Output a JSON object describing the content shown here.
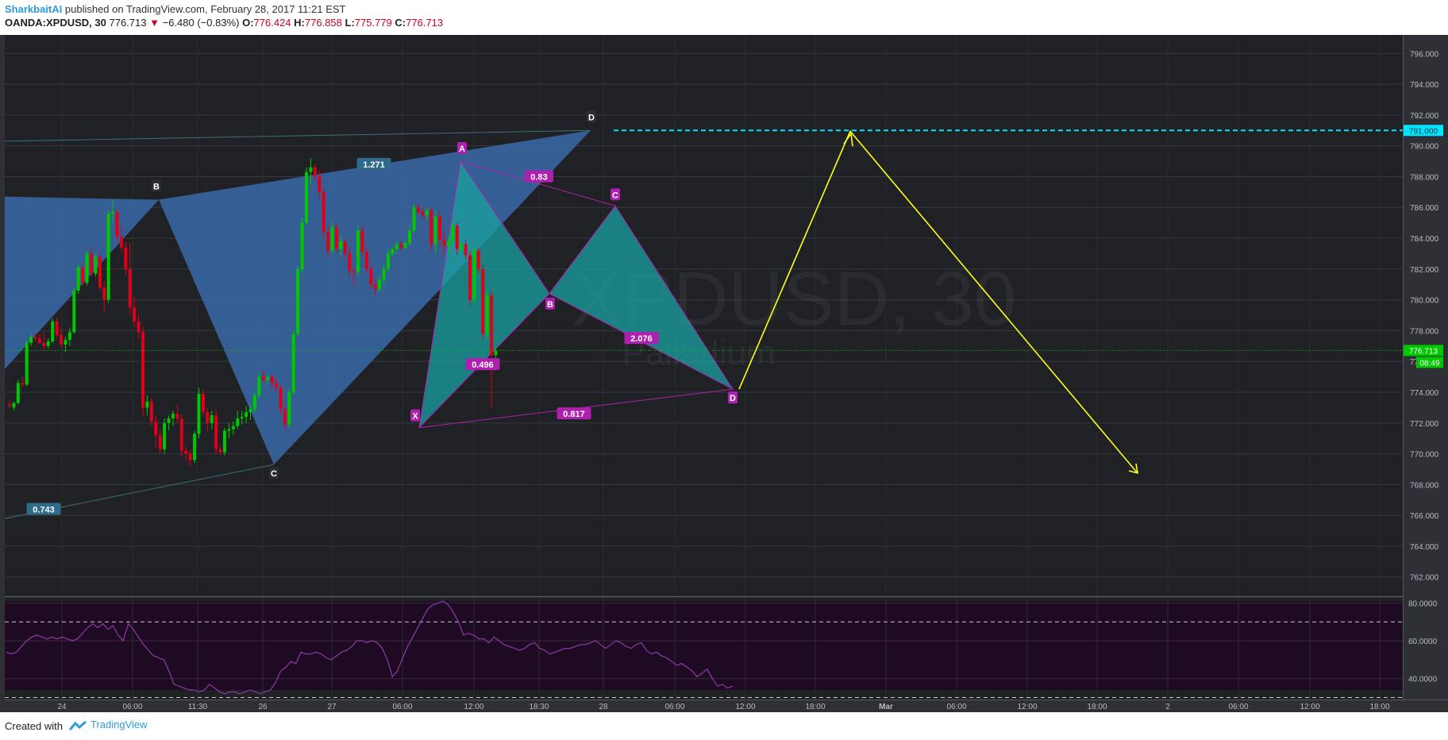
{
  "header": {
    "author": "SharkbaitAI",
    "published": "published on TradingView.com, February 28, 2017 11:21 EST",
    "symbol": "OANDA:XPDUSD, 30",
    "last": "776.713",
    "change_arrow": "▼",
    "change": "−6.480 (−0.83%)",
    "o_label": "O:",
    "o": "776.424",
    "h_label": "H:",
    "h": "776.858",
    "l_label": "L:",
    "l": "775.779",
    "c_label": "C:",
    "c": "776.713"
  },
  "watermark": {
    "symbol": "XPDUSD, 30",
    "name": "Palladium"
  },
  "footer": {
    "created_with": "Created with",
    "tradingview": "TradingView"
  },
  "colors": {
    "up": "#00c800",
    "down": "#e0001b",
    "harmonic_blue": "#3a6aa8",
    "harmonic_teal": "#1aa0a0",
    "harmonic_purple": "#b020b0",
    "target_line": "#00e5ff",
    "projection": "#ffff1a",
    "rsi_line": "#8e3aa8",
    "rsi_bg": "#1e0a22"
  },
  "chart_data": [
    {
      "type": "candlestick",
      "title": "OANDA:XPDUSD, 30",
      "ylim": [
        760.8,
        797.2
      ],
      "y_ticks": [
        "796.000",
        "794.000",
        "792.000",
        "790.000",
        "788.000",
        "786.000",
        "784.000",
        "782.000",
        "780.000",
        "778.000",
        "776.000",
        "774.000",
        "772.000",
        "770.000",
        "768.000",
        "766.000",
        "764.000",
        "762.000"
      ],
      "x_ticks": [
        "24",
        "06:00",
        "11:30",
        "26",
        "27",
        "06:00",
        "12:00",
        "18:30",
        "28",
        "06:00",
        "12:00",
        "18:00",
        "Mar",
        "06:00",
        "12:00",
        "18:00",
        "2",
        "06:00",
        "12:00",
        "18:00"
      ],
      "price_labels": {
        "target": {
          "value": 791.0,
          "label": "791.000"
        },
        "last": {
          "value": 776.713,
          "label": "776.713"
        },
        "countdown": "08:49"
      },
      "harmonic_patterns": [
        {
          "name": "blue",
          "points": {
            "X": 775.5,
            "A": 786.5,
            "B": 769.3,
            "C": 791.0
          },
          "labels": [
            {
              "text": "B",
              "value": 786.5
            },
            {
              "text": "C",
              "value": 769.3
            },
            {
              "text": "D",
              "value": 791.0
            }
          ],
          "ratios": [
            "1.271",
            "0.743"
          ]
        },
        {
          "name": "purple",
          "points": {
            "X": 771.7,
            "A": 789.0,
            "B": 780.4,
            "C": 786.1,
            "D": 774.2
          },
          "labels": [
            "X",
            "A",
            "B",
            "C",
            "D"
          ],
          "ratios": [
            "0.83",
            "0.496",
            "2.076",
            "0.817"
          ]
        }
      ],
      "projection_path": {
        "from": 774.2,
        "peak": 791.0,
        "target": 768.8
      },
      "candles": [
        {
          "o": 773.2,
          "h": 773.5,
          "l": 773.0,
          "c": 773.1
        },
        {
          "o": 773.0,
          "h": 773.4,
          "l": 772.8,
          "c": 773.3
        },
        {
          "o": 773.3,
          "h": 774.8,
          "l": 773.2,
          "c": 774.6
        },
        {
          "o": 774.6,
          "h": 775.0,
          "l": 774.3,
          "c": 774.5
        },
        {
          "o": 774.5,
          "h": 777.4,
          "l": 774.4,
          "c": 777.2
        },
        {
          "o": 777.2,
          "h": 777.8,
          "l": 777.0,
          "c": 777.6
        },
        {
          "o": 777.6,
          "h": 777.8,
          "l": 777.3,
          "c": 777.5
        },
        {
          "o": 777.5,
          "h": 777.8,
          "l": 777.1,
          "c": 777.2
        },
        {
          "o": 777.2,
          "h": 777.9,
          "l": 776.7,
          "c": 777.0
        },
        {
          "o": 777.0,
          "h": 777.5,
          "l": 776.8,
          "c": 777.3
        },
        {
          "o": 777.3,
          "h": 778.8,
          "l": 777.2,
          "c": 778.6
        },
        {
          "o": 778.6,
          "h": 778.9,
          "l": 777.5,
          "c": 777.7
        },
        {
          "o": 777.7,
          "h": 778.2,
          "l": 776.9,
          "c": 777.1
        },
        {
          "o": 777.1,
          "h": 777.6,
          "l": 776.6,
          "c": 777.4
        },
        {
          "o": 777.4,
          "h": 778.2,
          "l": 777.0,
          "c": 777.9
        },
        {
          "o": 777.9,
          "h": 780.8,
          "l": 777.8,
          "c": 780.6
        },
        {
          "o": 780.6,
          "h": 782.3,
          "l": 780.4,
          "c": 782.1
        },
        {
          "o": 782.1,
          "h": 782.3,
          "l": 780.9,
          "c": 781.1
        },
        {
          "o": 781.1,
          "h": 783.2,
          "l": 780.9,
          "c": 783.0
        },
        {
          "o": 783.0,
          "h": 783.4,
          "l": 781.5,
          "c": 781.7
        },
        {
          "o": 781.7,
          "h": 783.0,
          "l": 781.5,
          "c": 782.8
        },
        {
          "o": 782.8,
          "h": 783.0,
          "l": 780.6,
          "c": 780.8
        },
        {
          "o": 780.8,
          "h": 781.2,
          "l": 779.2,
          "c": 780.0
        },
        {
          "o": 780.0,
          "h": 785.8,
          "l": 779.8,
          "c": 785.6
        },
        {
          "o": 785.6,
          "h": 786.5,
          "l": 785.0,
          "c": 785.7
        },
        {
          "o": 785.7,
          "h": 785.9,
          "l": 783.8,
          "c": 784.1
        },
        {
          "o": 784.1,
          "h": 784.8,
          "l": 783.0,
          "c": 783.4
        },
        {
          "o": 783.4,
          "h": 783.8,
          "l": 781.6,
          "c": 782.0
        },
        {
          "o": 782.0,
          "h": 783.7,
          "l": 779.0,
          "c": 779.5
        },
        {
          "o": 779.5,
          "h": 780.2,
          "l": 778.3,
          "c": 778.6
        },
        {
          "o": 778.6,
          "h": 779.0,
          "l": 777.5,
          "c": 777.9
        },
        {
          "o": 777.9,
          "h": 778.2,
          "l": 772.4,
          "c": 773.0
        },
        {
          "o": 773.0,
          "h": 773.8,
          "l": 772.5,
          "c": 773.4
        },
        {
          "o": 773.4,
          "h": 773.6,
          "l": 771.8,
          "c": 772.1
        },
        {
          "o": 772.1,
          "h": 772.5,
          "l": 770.4,
          "c": 771.2
        },
        {
          "o": 771.2,
          "h": 771.6,
          "l": 770.0,
          "c": 770.3
        },
        {
          "o": 770.3,
          "h": 772.3,
          "l": 770.0,
          "c": 772.0
        },
        {
          "o": 772.0,
          "h": 772.5,
          "l": 771.5,
          "c": 772.3
        },
        {
          "o": 772.3,
          "h": 772.8,
          "l": 771.8,
          "c": 772.6
        },
        {
          "o": 772.6,
          "h": 773.2,
          "l": 772.0,
          "c": 772.3
        },
        {
          "o": 772.3,
          "h": 772.6,
          "l": 769.8,
          "c": 770.2
        },
        {
          "o": 770.2,
          "h": 770.5,
          "l": 769.5,
          "c": 770.0
        },
        {
          "o": 770.0,
          "h": 770.3,
          "l": 769.2,
          "c": 769.6
        },
        {
          "o": 769.6,
          "h": 771.5,
          "l": 769.4,
          "c": 771.3
        },
        {
          "o": 771.3,
          "h": 774.3,
          "l": 771.0,
          "c": 773.9
        },
        {
          "o": 773.9,
          "h": 774.2,
          "l": 772.4,
          "c": 772.7
        },
        {
          "o": 772.7,
          "h": 773.0,
          "l": 771.5,
          "c": 772.0
        },
        {
          "o": 772.0,
          "h": 772.8,
          "l": 771.6,
          "c": 772.5
        },
        {
          "o": 772.5,
          "h": 772.9,
          "l": 770.0,
          "c": 770.3
        },
        {
          "o": 770.3,
          "h": 770.5,
          "l": 769.9,
          "c": 770.1
        },
        {
          "o": 770.1,
          "h": 771.7,
          "l": 769.9,
          "c": 771.5
        },
        {
          "o": 771.5,
          "h": 772.0,
          "l": 771.0,
          "c": 771.6
        },
        {
          "o": 771.6,
          "h": 772.1,
          "l": 771.2,
          "c": 771.8
        },
        {
          "o": 771.8,
          "h": 772.8,
          "l": 771.6,
          "c": 772.3
        },
        {
          "o": 772.3,
          "h": 772.8,
          "l": 771.9,
          "c": 772.4
        },
        {
          "o": 772.4,
          "h": 773.1,
          "l": 772.0,
          "c": 772.7
        },
        {
          "o": 772.7,
          "h": 773.2,
          "l": 772.2,
          "c": 772.9
        },
        {
          "o": 772.9,
          "h": 774.0,
          "l": 772.7,
          "c": 773.8
        },
        {
          "o": 773.8,
          "h": 775.3,
          "l": 773.6,
          "c": 775.0
        },
        {
          "o": 775.0,
          "h": 775.4,
          "l": 774.6,
          "c": 774.8
        },
        {
          "o": 774.8,
          "h": 775.2,
          "l": 774.5,
          "c": 775.0
        },
        {
          "o": 775.0,
          "h": 775.1,
          "l": 774.3,
          "c": 774.6
        },
        {
          "o": 774.6,
          "h": 774.9,
          "l": 774.0,
          "c": 774.3
        },
        {
          "o": 774.3,
          "h": 774.5,
          "l": 772.6,
          "c": 772.9
        },
        {
          "o": 772.9,
          "h": 773.2,
          "l": 771.5,
          "c": 771.9
        },
        {
          "o": 771.9,
          "h": 774.3,
          "l": 771.7,
          "c": 774.0
        },
        {
          "o": 774.0,
          "h": 778.0,
          "l": 773.8,
          "c": 777.8
        },
        {
          "o": 777.8,
          "h": 782.2,
          "l": 777.6,
          "c": 782.0
        },
        {
          "o": 782.0,
          "h": 785.3,
          "l": 781.8,
          "c": 785.0
        },
        {
          "o": 785.0,
          "h": 788.6,
          "l": 784.8,
          "c": 788.3
        },
        {
          "o": 788.3,
          "h": 789.2,
          "l": 787.5,
          "c": 788.6
        },
        {
          "o": 788.6,
          "h": 788.8,
          "l": 787.8,
          "c": 788.0
        },
        {
          "o": 788.0,
          "h": 788.4,
          "l": 786.6,
          "c": 787.0
        },
        {
          "o": 787.0,
          "h": 787.3,
          "l": 784.0,
          "c": 784.4
        },
        {
          "o": 784.4,
          "h": 784.8,
          "l": 782.8,
          "c": 783.2
        },
        {
          "o": 783.2,
          "h": 785.0,
          "l": 783.0,
          "c": 784.7
        },
        {
          "o": 784.7,
          "h": 785.0,
          "l": 783.0,
          "c": 783.3
        },
        {
          "o": 783.3,
          "h": 784.2,
          "l": 782.9,
          "c": 783.8
        },
        {
          "o": 783.8,
          "h": 784.0,
          "l": 782.7,
          "c": 783.0
        },
        {
          "o": 783.0,
          "h": 783.4,
          "l": 781.5,
          "c": 781.9
        },
        {
          "o": 781.9,
          "h": 782.2,
          "l": 780.9,
          "c": 781.8
        },
        {
          "o": 781.8,
          "h": 784.8,
          "l": 781.6,
          "c": 784.5
        },
        {
          "o": 784.5,
          "h": 784.8,
          "l": 782.8,
          "c": 783.1
        },
        {
          "o": 783.1,
          "h": 783.4,
          "l": 781.7,
          "c": 782.0
        },
        {
          "o": 782.0,
          "h": 782.3,
          "l": 780.7,
          "c": 781.0
        },
        {
          "o": 781.0,
          "h": 781.4,
          "l": 780.3,
          "c": 780.7
        },
        {
          "o": 780.7,
          "h": 781.6,
          "l": 780.5,
          "c": 781.3
        },
        {
          "o": 781.3,
          "h": 782.3,
          "l": 781.0,
          "c": 782.0
        },
        {
          "o": 782.0,
          "h": 783.3,
          "l": 781.8,
          "c": 783.0
        },
        {
          "o": 783.0,
          "h": 783.5,
          "l": 782.8,
          "c": 783.3
        },
        {
          "o": 783.3,
          "h": 783.8,
          "l": 783.0,
          "c": 783.6
        },
        {
          "o": 783.6,
          "h": 783.8,
          "l": 783.2,
          "c": 783.4
        },
        {
          "o": 783.4,
          "h": 783.9,
          "l": 783.2,
          "c": 783.7
        },
        {
          "o": 783.7,
          "h": 784.8,
          "l": 783.5,
          "c": 784.5
        },
        {
          "o": 784.5,
          "h": 786.2,
          "l": 784.3,
          "c": 786.0
        },
        {
          "o": 786.0,
          "h": 786.3,
          "l": 785.5,
          "c": 785.7
        },
        {
          "o": 785.7,
          "h": 786.0,
          "l": 785.2,
          "c": 785.5
        },
        {
          "o": 785.5,
          "h": 786.0,
          "l": 785.2,
          "c": 785.8
        },
        {
          "o": 785.8,
          "h": 786.0,
          "l": 783.2,
          "c": 783.6
        },
        {
          "o": 783.6,
          "h": 785.8,
          "l": 783.0,
          "c": 785.4
        },
        {
          "o": 785.4,
          "h": 785.7,
          "l": 783.5,
          "c": 783.9
        },
        {
          "o": 783.9,
          "h": 784.5,
          "l": 783.0,
          "c": 783.5
        },
        {
          "o": 783.5,
          "h": 784.2,
          "l": 783.0,
          "c": 783.8
        },
        {
          "o": 783.8,
          "h": 785.1,
          "l": 783.6,
          "c": 784.8
        },
        {
          "o": 784.8,
          "h": 785.0,
          "l": 782.9,
          "c": 783.3
        },
        {
          "o": 783.3,
          "h": 783.8,
          "l": 783.0,
          "c": 783.6
        },
        {
          "o": 783.6,
          "h": 783.9,
          "l": 782.6,
          "c": 782.9
        },
        {
          "o": 782.9,
          "h": 783.2,
          "l": 779.6,
          "c": 780.0
        },
        {
          "o": 780.0,
          "h": 783.5,
          "l": 779.8,
          "c": 783.2
        },
        {
          "o": 783.2,
          "h": 783.4,
          "l": 781.7,
          "c": 782.0
        },
        {
          "o": 782.0,
          "h": 782.3,
          "l": 777.4,
          "c": 777.8
        },
        {
          "o": 777.8,
          "h": 780.7,
          "l": 777.5,
          "c": 780.3
        },
        {
          "o": 780.3,
          "h": 780.6,
          "l": 773.0,
          "c": 776.4
        },
        {
          "o": 776.4,
          "h": 776.9,
          "l": 775.8,
          "c": 776.7
        }
      ]
    },
    {
      "type": "line",
      "title": "RSI",
      "ylim": [
        34.0,
        81.0
      ],
      "y_ticks": [
        "80.0000",
        "60.0000",
        "40.0000"
      ],
      "levels": [
        70,
        30
      ],
      "series": [
        {
          "values": [
            54,
            53,
            54,
            57,
            60,
            62,
            63,
            62,
            61,
            62,
            61,
            62,
            61,
            60,
            61,
            64,
            67,
            69,
            67,
            69,
            66,
            68,
            63,
            60,
            69,
            66,
            62,
            58,
            55,
            52,
            51,
            50,
            44,
            37,
            36,
            35,
            34,
            34,
            33,
            34,
            37,
            35,
            33,
            32,
            33,
            33,
            32,
            33,
            34,
            33,
            32,
            33,
            34,
            38,
            44,
            46,
            49,
            48,
            54,
            53,
            53,
            54,
            53,
            51,
            50,
            52,
            54,
            55,
            57,
            60,
            60,
            59,
            60,
            59,
            56,
            50,
            41,
            44,
            51,
            57,
            62,
            67,
            72,
            77,
            79,
            80,
            81,
            79,
            75,
            70,
            63,
            64,
            63,
            61,
            61,
            59,
            62,
            60,
            58,
            57,
            56,
            55,
            56,
            58,
            59,
            56,
            55,
            53,
            54,
            55,
            56,
            56,
            57,
            58,
            58,
            59,
            60,
            58,
            56,
            58,
            60,
            59,
            57,
            56,
            58,
            59,
            55,
            53,
            54,
            52,
            51,
            49,
            47,
            48,
            46,
            44,
            41,
            43,
            45,
            40,
            36,
            37,
            35,
            36
          ]
        }
      ]
    }
  ]
}
